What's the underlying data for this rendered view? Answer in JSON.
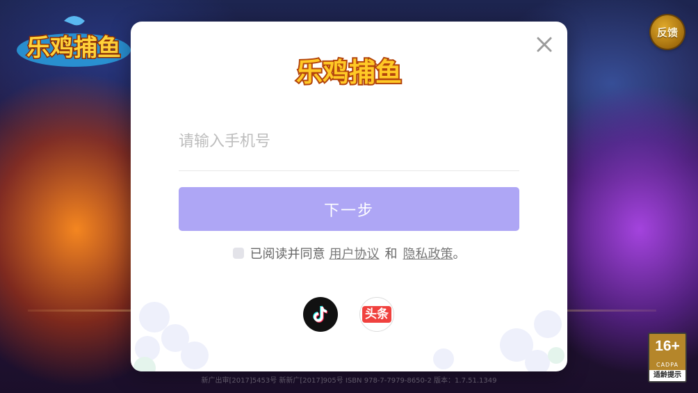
{
  "background": {
    "logo_text": "乐鸡捕鱼",
    "footer_text": "新广出审[2017]5453号   新新广[2017]905号   ISBN 978-7-7979-8650-2   版本：1.7.51.1349"
  },
  "feedback": {
    "label": "反馈"
  },
  "age_rating": {
    "age": "16+",
    "org": "CADPA",
    "tip": "适龄提示"
  },
  "modal": {
    "logo_text": "乐鸡捕鱼",
    "close_icon": "close-icon",
    "phone_input": {
      "placeholder": "请输入手机号",
      "value": ""
    },
    "next_button": "下一步",
    "agreement": {
      "prefix": "已阅读并同意",
      "user_agreement": "用户协议",
      "and": "和",
      "privacy_policy": "隐私政策",
      "suffix": "。",
      "checked": false
    },
    "social_logins": [
      {
        "name": "douyin",
        "icon": "douyin-icon"
      },
      {
        "name": "toutiao",
        "label": "头条",
        "icon": "toutiao-icon"
      }
    ]
  },
  "colors": {
    "button": "#aea6f5",
    "feedback_gold": "#c48a16",
    "toutiao_red": "#f0413e"
  }
}
